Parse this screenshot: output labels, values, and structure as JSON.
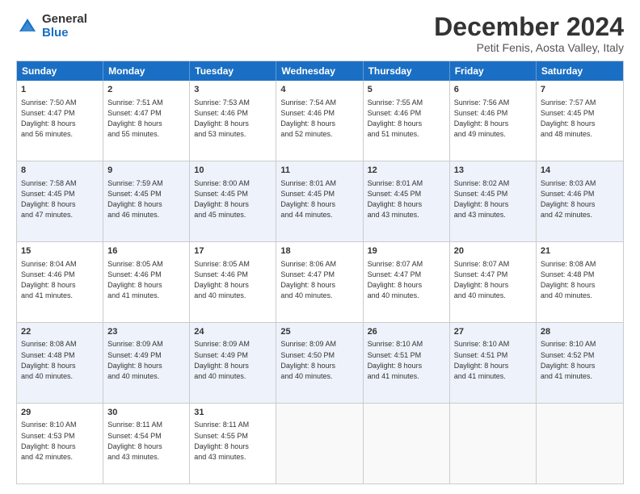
{
  "logo": {
    "general": "General",
    "blue": "Blue"
  },
  "title": "December 2024",
  "subtitle": "Petit Fenis, Aosta Valley, Italy",
  "weekdays": [
    "Sunday",
    "Monday",
    "Tuesday",
    "Wednesday",
    "Thursday",
    "Friday",
    "Saturday"
  ],
  "rows": [
    [
      {
        "day": "1",
        "lines": [
          "Sunrise: 7:50 AM",
          "Sunset: 4:47 PM",
          "Daylight: 8 hours",
          "and 56 minutes."
        ]
      },
      {
        "day": "2",
        "lines": [
          "Sunrise: 7:51 AM",
          "Sunset: 4:47 PM",
          "Daylight: 8 hours",
          "and 55 minutes."
        ]
      },
      {
        "day": "3",
        "lines": [
          "Sunrise: 7:53 AM",
          "Sunset: 4:46 PM",
          "Daylight: 8 hours",
          "and 53 minutes."
        ]
      },
      {
        "day": "4",
        "lines": [
          "Sunrise: 7:54 AM",
          "Sunset: 4:46 PM",
          "Daylight: 8 hours",
          "and 52 minutes."
        ]
      },
      {
        "day": "5",
        "lines": [
          "Sunrise: 7:55 AM",
          "Sunset: 4:46 PM",
          "Daylight: 8 hours",
          "and 51 minutes."
        ]
      },
      {
        "day": "6",
        "lines": [
          "Sunrise: 7:56 AM",
          "Sunset: 4:46 PM",
          "Daylight: 8 hours",
          "and 49 minutes."
        ]
      },
      {
        "day": "7",
        "lines": [
          "Sunrise: 7:57 AM",
          "Sunset: 4:45 PM",
          "Daylight: 8 hours",
          "and 48 minutes."
        ]
      }
    ],
    [
      {
        "day": "8",
        "lines": [
          "Sunrise: 7:58 AM",
          "Sunset: 4:45 PM",
          "Daylight: 8 hours",
          "and 47 minutes."
        ]
      },
      {
        "day": "9",
        "lines": [
          "Sunrise: 7:59 AM",
          "Sunset: 4:45 PM",
          "Daylight: 8 hours",
          "and 46 minutes."
        ]
      },
      {
        "day": "10",
        "lines": [
          "Sunrise: 8:00 AM",
          "Sunset: 4:45 PM",
          "Daylight: 8 hours",
          "and 45 minutes."
        ]
      },
      {
        "day": "11",
        "lines": [
          "Sunrise: 8:01 AM",
          "Sunset: 4:45 PM",
          "Daylight: 8 hours",
          "and 44 minutes."
        ]
      },
      {
        "day": "12",
        "lines": [
          "Sunrise: 8:01 AM",
          "Sunset: 4:45 PM",
          "Daylight: 8 hours",
          "and 43 minutes."
        ]
      },
      {
        "day": "13",
        "lines": [
          "Sunrise: 8:02 AM",
          "Sunset: 4:45 PM",
          "Daylight: 8 hours",
          "and 43 minutes."
        ]
      },
      {
        "day": "14",
        "lines": [
          "Sunrise: 8:03 AM",
          "Sunset: 4:46 PM",
          "Daylight: 8 hours",
          "and 42 minutes."
        ]
      }
    ],
    [
      {
        "day": "15",
        "lines": [
          "Sunrise: 8:04 AM",
          "Sunset: 4:46 PM",
          "Daylight: 8 hours",
          "and 41 minutes."
        ]
      },
      {
        "day": "16",
        "lines": [
          "Sunrise: 8:05 AM",
          "Sunset: 4:46 PM",
          "Daylight: 8 hours",
          "and 41 minutes."
        ]
      },
      {
        "day": "17",
        "lines": [
          "Sunrise: 8:05 AM",
          "Sunset: 4:46 PM",
          "Daylight: 8 hours",
          "and 40 minutes."
        ]
      },
      {
        "day": "18",
        "lines": [
          "Sunrise: 8:06 AM",
          "Sunset: 4:47 PM",
          "Daylight: 8 hours",
          "and 40 minutes."
        ]
      },
      {
        "day": "19",
        "lines": [
          "Sunrise: 8:07 AM",
          "Sunset: 4:47 PM",
          "Daylight: 8 hours",
          "and 40 minutes."
        ]
      },
      {
        "day": "20",
        "lines": [
          "Sunrise: 8:07 AM",
          "Sunset: 4:47 PM",
          "Daylight: 8 hours",
          "and 40 minutes."
        ]
      },
      {
        "day": "21",
        "lines": [
          "Sunrise: 8:08 AM",
          "Sunset: 4:48 PM",
          "Daylight: 8 hours",
          "and 40 minutes."
        ]
      }
    ],
    [
      {
        "day": "22",
        "lines": [
          "Sunrise: 8:08 AM",
          "Sunset: 4:48 PM",
          "Daylight: 8 hours",
          "and 40 minutes."
        ]
      },
      {
        "day": "23",
        "lines": [
          "Sunrise: 8:09 AM",
          "Sunset: 4:49 PM",
          "Daylight: 8 hours",
          "and 40 minutes."
        ]
      },
      {
        "day": "24",
        "lines": [
          "Sunrise: 8:09 AM",
          "Sunset: 4:49 PM",
          "Daylight: 8 hours",
          "and 40 minutes."
        ]
      },
      {
        "day": "25",
        "lines": [
          "Sunrise: 8:09 AM",
          "Sunset: 4:50 PM",
          "Daylight: 8 hours",
          "and 40 minutes."
        ]
      },
      {
        "day": "26",
        "lines": [
          "Sunrise: 8:10 AM",
          "Sunset: 4:51 PM",
          "Daylight: 8 hours",
          "and 41 minutes."
        ]
      },
      {
        "day": "27",
        "lines": [
          "Sunrise: 8:10 AM",
          "Sunset: 4:51 PM",
          "Daylight: 8 hours",
          "and 41 minutes."
        ]
      },
      {
        "day": "28",
        "lines": [
          "Sunrise: 8:10 AM",
          "Sunset: 4:52 PM",
          "Daylight: 8 hours",
          "and 41 minutes."
        ]
      }
    ],
    [
      {
        "day": "29",
        "lines": [
          "Sunrise: 8:10 AM",
          "Sunset: 4:53 PM",
          "Daylight: 8 hours",
          "and 42 minutes."
        ]
      },
      {
        "day": "30",
        "lines": [
          "Sunrise: 8:11 AM",
          "Sunset: 4:54 PM",
          "Daylight: 8 hours",
          "and 43 minutes."
        ]
      },
      {
        "day": "31",
        "lines": [
          "Sunrise: 8:11 AM",
          "Sunset: 4:55 PM",
          "Daylight: 8 hours",
          "and 43 minutes."
        ]
      },
      {
        "day": "",
        "lines": []
      },
      {
        "day": "",
        "lines": []
      },
      {
        "day": "",
        "lines": []
      },
      {
        "day": "",
        "lines": []
      }
    ]
  ]
}
